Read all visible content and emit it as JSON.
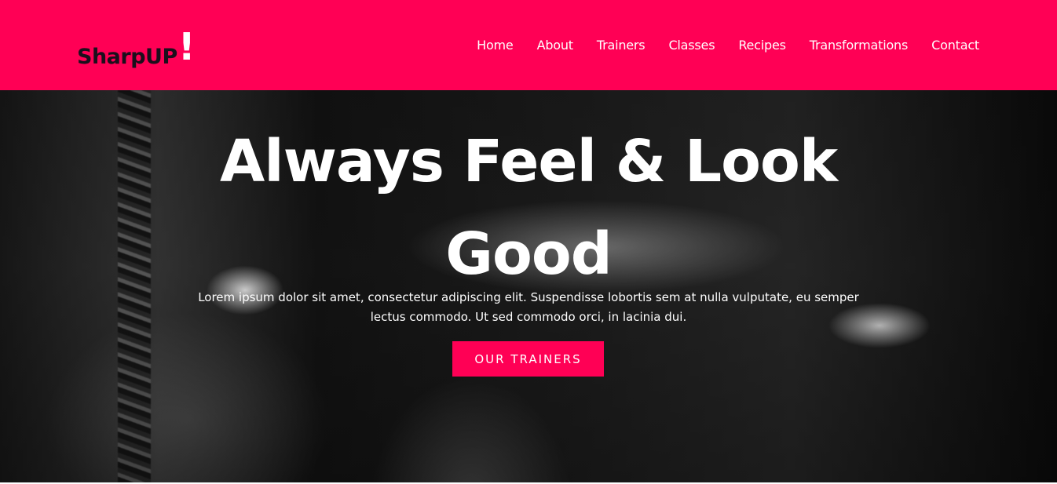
{
  "header": {
    "logo_text": "SharpUP",
    "logo_mark": "!",
    "nav": [
      "Home",
      "About",
      "Trainers",
      "Classes",
      "Recipes",
      "Transformations",
      "Contact"
    ]
  },
  "hero": {
    "title_line_1": "Always Feel & Look",
    "title_line_2": "Good",
    "paragraph_line_1": "Lorem ipsum dolor sit amet, consectetur adipiscing elit. Suspendisse lobortis sem at nulla vulputate, eu semper",
    "paragraph_line_2": "lectus commodo. Ut sed commodo orci, in lacinia dui.",
    "button_label": "OUR TRAINERS"
  },
  "colors": {
    "brand": "#ff0055",
    "logo_text": "#1b0f1c",
    "text_light": "#ffffff"
  }
}
